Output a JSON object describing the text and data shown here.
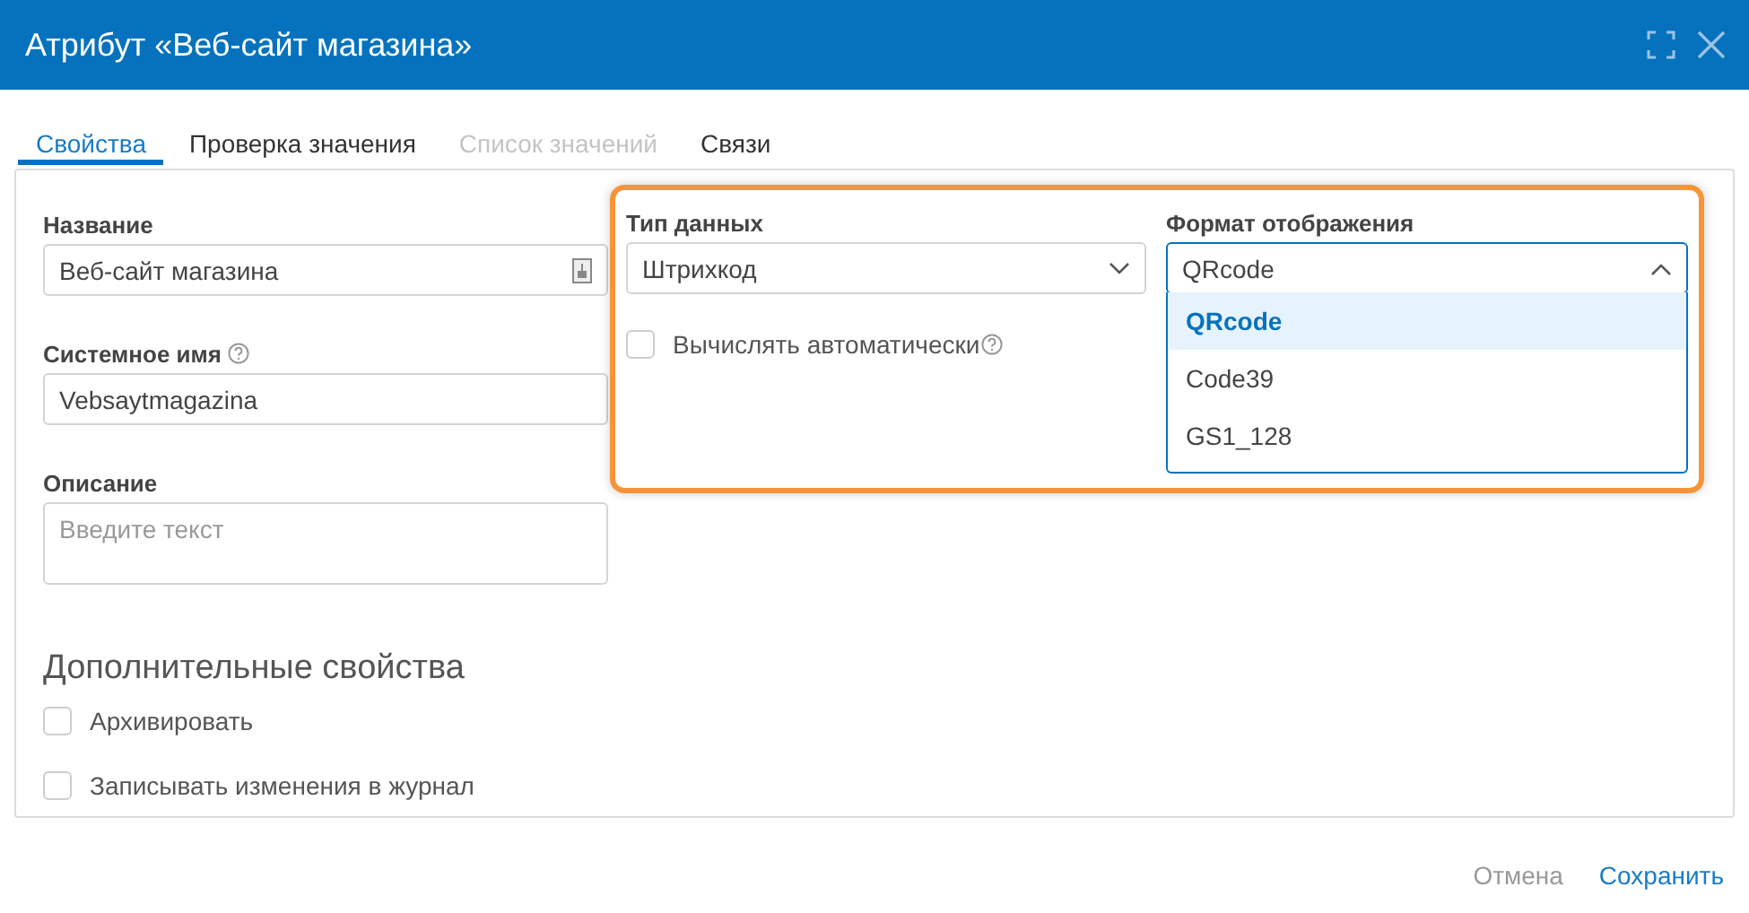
{
  "window": {
    "title": "Атрибут «Веб-сайт магазина»"
  },
  "tabs": [
    {
      "label": "Свойства",
      "selected": true,
      "disabled": false
    },
    {
      "label": "Проверка значения",
      "selected": false,
      "disabled": false
    },
    {
      "label": "Список значений",
      "selected": false,
      "disabled": true
    },
    {
      "label": "Связи",
      "selected": false,
      "disabled": false
    }
  ],
  "fields": [
    {
      "label": "Название",
      "value": "Веб-сайт магазина",
      "help": false,
      "kind": "text"
    },
    {
      "label": "Системное имя",
      "value": "Vebsaytmagazina",
      "help": true,
      "kind": "text"
    },
    {
      "label": "Описание",
      "placeholder": "Введите текст",
      "help": false,
      "kind": "textarea"
    }
  ],
  "data_type": {
    "label": "Тип данных",
    "value": "Штрихкод",
    "expanded": false
  },
  "display_format": {
    "label": "Формат отображения",
    "value": "QRcode",
    "expanded": true,
    "options": [
      {
        "label": "QRcode",
        "selected": true
      },
      {
        "label": "Code39",
        "selected": false
      },
      {
        "label": "GS1_128",
        "selected": false
      }
    ]
  },
  "auto_compute": {
    "label": "Вычислять автоматически",
    "checked": false
  },
  "extra": {
    "title": "Дополнительные свойства",
    "options": [
      {
        "label": "Архивировать",
        "checked": false
      },
      {
        "label": "Записывать изменения в журнал",
        "checked": false
      }
    ]
  },
  "buttons": [
    {
      "label": "Отмена",
      "kind": "secondary"
    },
    {
      "label": "Сохранить",
      "kind": "primary"
    }
  ]
}
